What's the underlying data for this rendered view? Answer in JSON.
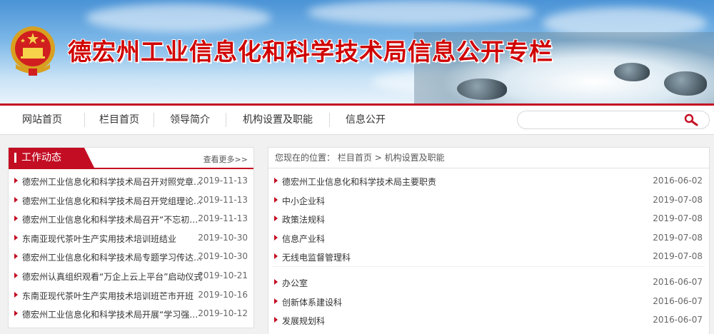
{
  "header": {
    "title": "德宏州工业信息化和科学技术局信息公开专栏"
  },
  "nav": {
    "items": [
      "网站首页",
      "栏目首页",
      "领导简介",
      "机构设置及职能",
      "信息公开"
    ],
    "search_placeholder": ""
  },
  "news": {
    "title": "工作动态",
    "more": "查看更多>>",
    "items": [
      {
        "title": "德宏州工业信息化和科学技术局召开对照党章党规找差距专题会议",
        "date": "2019-11-13"
      },
      {
        "title": "德宏州工业信息化和科学技术局召开党组理论学习中心组学习会议",
        "date": "2019-11-13"
      },
      {
        "title": "德宏州工业信息化和科学技术局召开“不忘初心、牢记使命”主题教育会议",
        "date": "2019-11-13"
      },
      {
        "title": "东南亚现代茶叶生产实用技术培训班结业",
        "date": "2019-10-30"
      },
      {
        "title": "德宏州工业信息化和科学技术局专题学习传达会议精神",
        "date": "2019-10-30"
      },
      {
        "title": "德宏州认真组织观看“万企上云上平台”启动仪式",
        "date": "2019-10-21"
      },
      {
        "title": "东南亚现代茶叶生产实用技术培训班芒市开班",
        "date": "2019-10-16"
      },
      {
        "title": "德宏州工业信息化和科学技术局开展“学习强国”学习活动",
        "date": "2019-10-12"
      }
    ]
  },
  "breadcrumb": {
    "prefix": "您现在的位置：",
    "home": "栏目首页",
    "sep": ">",
    "current": "机构设置及职能"
  },
  "list": {
    "group1": [
      {
        "title": "德宏州工业信息化和科学技术局主要职责",
        "date": "2016-06-02"
      },
      {
        "title": "中小企业科",
        "date": "2019-07-08"
      },
      {
        "title": "政策法规科",
        "date": "2019-07-08"
      },
      {
        "title": "信息产业科",
        "date": "2019-07-08"
      },
      {
        "title": "无线电监督管理科",
        "date": "2019-07-08"
      }
    ],
    "group2": [
      {
        "title": "办公室",
        "date": "2016-06-07"
      },
      {
        "title": "创新体系建设科",
        "date": "2016-06-07"
      },
      {
        "title": "发展规划科",
        "date": "2016-06-07"
      }
    ]
  },
  "colors": {
    "accent": "#c30d23",
    "title_red": "#d00000"
  }
}
